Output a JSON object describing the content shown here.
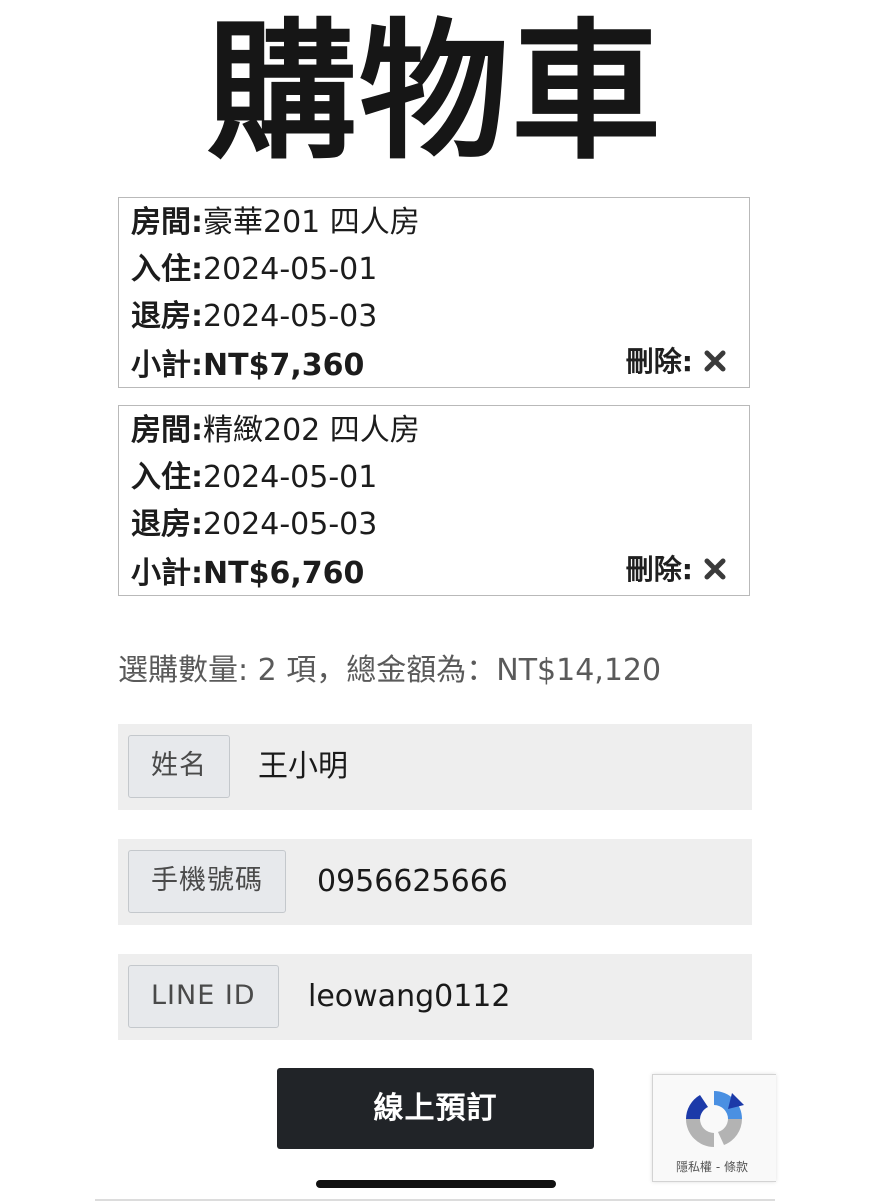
{
  "page": {
    "title": "購物車"
  },
  "cart": {
    "items": [
      {
        "room_label": "房間:",
        "room": "豪華201 四人房",
        "checkin_label": "入住:",
        "checkin": "2024-05-01",
        "checkout_label": "退房:",
        "checkout": "2024-05-03",
        "subtotal_label": "小計:",
        "subtotal": "NT$7,360",
        "delete_label": "刪除:"
      },
      {
        "room_label": "房間:",
        "room": "精緻202 四人房",
        "checkin_label": "入住:",
        "checkin": "2024-05-01",
        "checkout_label": "退房:",
        "checkout": "2024-05-03",
        "subtotal_label": "小計:",
        "subtotal": "NT$6,760",
        "delete_label": "刪除:"
      }
    ],
    "summary": "選購數量: 2 項，總金額為：NT$14,120"
  },
  "form": {
    "name_label": "姓名",
    "name_value": "王小明",
    "phone_label": "手機號碼",
    "phone_value": "0956625666",
    "line_label": "LINE ID",
    "line_value": "leowang0112",
    "submit_label": "線上預訂"
  },
  "recaptcha": {
    "links": "隱私權 - 條款"
  },
  "colors": {
    "button_bg": "#212428",
    "field_bg": "#eeeeee",
    "recaptcha_blue": "#4a90e2",
    "recaptcha_dark_blue": "#1c3aa9",
    "recaptcha_gray": "#b3b3b3"
  }
}
